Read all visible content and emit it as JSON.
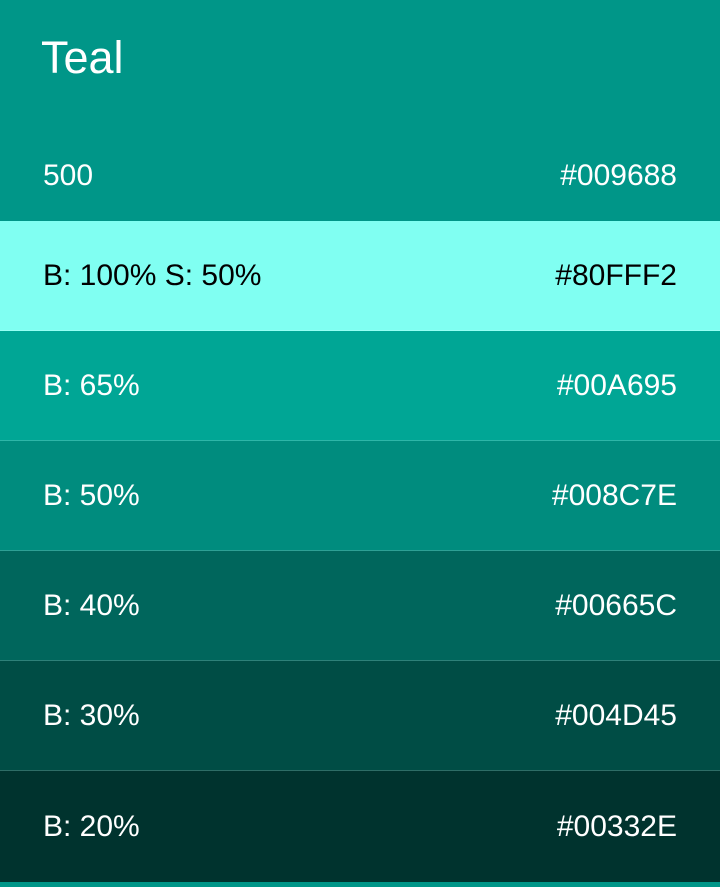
{
  "title": "Teal",
  "header": {
    "label": "500",
    "hex": "#009688"
  },
  "swatches": [
    {
      "label": "B: 100% S: 50%",
      "hex": "#80FFF2",
      "bg": "#80FFF2",
      "text": "#000000"
    },
    {
      "label": "B: 65%",
      "hex": "#00A695",
      "bg": "#00A695",
      "text": "#FFFFFF"
    },
    {
      "label": "B: 50%",
      "hex": "#008C7E",
      "bg": "#008C7E",
      "text": "#FFFFFF"
    },
    {
      "label": "B: 40%",
      "hex": "#00665C",
      "bg": "#00665C",
      "text": "#FFFFFF"
    },
    {
      "label": "B: 30%",
      "hex": "#004D45",
      "bg": "#004D45",
      "text": "#FFFFFF"
    },
    {
      "label": "B: 20%",
      "hex": "#00332E",
      "bg": "#00332E",
      "text": "#FFFFFF"
    }
  ]
}
